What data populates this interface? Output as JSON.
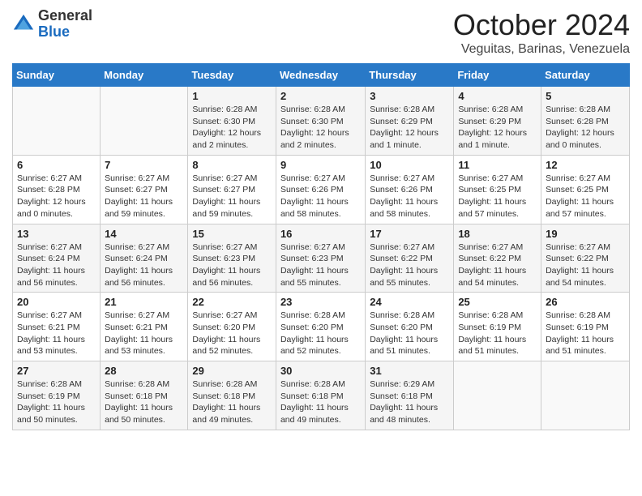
{
  "logo": {
    "general": "General",
    "blue": "Blue"
  },
  "header": {
    "month": "October 2024",
    "location": "Veguitas, Barinas, Venezuela"
  },
  "weekdays": [
    "Sunday",
    "Monday",
    "Tuesday",
    "Wednesday",
    "Thursday",
    "Friday",
    "Saturday"
  ],
  "weeks": [
    [
      {
        "day": "",
        "info": ""
      },
      {
        "day": "",
        "info": ""
      },
      {
        "day": "1",
        "info": "Sunrise: 6:28 AM\nSunset: 6:30 PM\nDaylight: 12 hours and 2 minutes."
      },
      {
        "day": "2",
        "info": "Sunrise: 6:28 AM\nSunset: 6:30 PM\nDaylight: 12 hours and 2 minutes."
      },
      {
        "day": "3",
        "info": "Sunrise: 6:28 AM\nSunset: 6:29 PM\nDaylight: 12 hours and 1 minute."
      },
      {
        "day": "4",
        "info": "Sunrise: 6:28 AM\nSunset: 6:29 PM\nDaylight: 12 hours and 1 minute."
      },
      {
        "day": "5",
        "info": "Sunrise: 6:28 AM\nSunset: 6:28 PM\nDaylight: 12 hours and 0 minutes."
      }
    ],
    [
      {
        "day": "6",
        "info": "Sunrise: 6:27 AM\nSunset: 6:28 PM\nDaylight: 12 hours and 0 minutes."
      },
      {
        "day": "7",
        "info": "Sunrise: 6:27 AM\nSunset: 6:27 PM\nDaylight: 11 hours and 59 minutes."
      },
      {
        "day": "8",
        "info": "Sunrise: 6:27 AM\nSunset: 6:27 PM\nDaylight: 11 hours and 59 minutes."
      },
      {
        "day": "9",
        "info": "Sunrise: 6:27 AM\nSunset: 6:26 PM\nDaylight: 11 hours and 58 minutes."
      },
      {
        "day": "10",
        "info": "Sunrise: 6:27 AM\nSunset: 6:26 PM\nDaylight: 11 hours and 58 minutes."
      },
      {
        "day": "11",
        "info": "Sunrise: 6:27 AM\nSunset: 6:25 PM\nDaylight: 11 hours and 57 minutes."
      },
      {
        "day": "12",
        "info": "Sunrise: 6:27 AM\nSunset: 6:25 PM\nDaylight: 11 hours and 57 minutes."
      }
    ],
    [
      {
        "day": "13",
        "info": "Sunrise: 6:27 AM\nSunset: 6:24 PM\nDaylight: 11 hours and 56 minutes."
      },
      {
        "day": "14",
        "info": "Sunrise: 6:27 AM\nSunset: 6:24 PM\nDaylight: 11 hours and 56 minutes."
      },
      {
        "day": "15",
        "info": "Sunrise: 6:27 AM\nSunset: 6:23 PM\nDaylight: 11 hours and 56 minutes."
      },
      {
        "day": "16",
        "info": "Sunrise: 6:27 AM\nSunset: 6:23 PM\nDaylight: 11 hours and 55 minutes."
      },
      {
        "day": "17",
        "info": "Sunrise: 6:27 AM\nSunset: 6:22 PM\nDaylight: 11 hours and 55 minutes."
      },
      {
        "day": "18",
        "info": "Sunrise: 6:27 AM\nSunset: 6:22 PM\nDaylight: 11 hours and 54 minutes."
      },
      {
        "day": "19",
        "info": "Sunrise: 6:27 AM\nSunset: 6:22 PM\nDaylight: 11 hours and 54 minutes."
      }
    ],
    [
      {
        "day": "20",
        "info": "Sunrise: 6:27 AM\nSunset: 6:21 PM\nDaylight: 11 hours and 53 minutes."
      },
      {
        "day": "21",
        "info": "Sunrise: 6:27 AM\nSunset: 6:21 PM\nDaylight: 11 hours and 53 minutes."
      },
      {
        "day": "22",
        "info": "Sunrise: 6:27 AM\nSunset: 6:20 PM\nDaylight: 11 hours and 52 minutes."
      },
      {
        "day": "23",
        "info": "Sunrise: 6:28 AM\nSunset: 6:20 PM\nDaylight: 11 hours and 52 minutes."
      },
      {
        "day": "24",
        "info": "Sunrise: 6:28 AM\nSunset: 6:20 PM\nDaylight: 11 hours and 51 minutes."
      },
      {
        "day": "25",
        "info": "Sunrise: 6:28 AM\nSunset: 6:19 PM\nDaylight: 11 hours and 51 minutes."
      },
      {
        "day": "26",
        "info": "Sunrise: 6:28 AM\nSunset: 6:19 PM\nDaylight: 11 hours and 51 minutes."
      }
    ],
    [
      {
        "day": "27",
        "info": "Sunrise: 6:28 AM\nSunset: 6:19 PM\nDaylight: 11 hours and 50 minutes."
      },
      {
        "day": "28",
        "info": "Sunrise: 6:28 AM\nSunset: 6:18 PM\nDaylight: 11 hours and 50 minutes."
      },
      {
        "day": "29",
        "info": "Sunrise: 6:28 AM\nSunset: 6:18 PM\nDaylight: 11 hours and 49 minutes."
      },
      {
        "day": "30",
        "info": "Sunrise: 6:28 AM\nSunset: 6:18 PM\nDaylight: 11 hours and 49 minutes."
      },
      {
        "day": "31",
        "info": "Sunrise: 6:29 AM\nSunset: 6:18 PM\nDaylight: 11 hours and 48 minutes."
      },
      {
        "day": "",
        "info": ""
      },
      {
        "day": "",
        "info": ""
      }
    ]
  ]
}
